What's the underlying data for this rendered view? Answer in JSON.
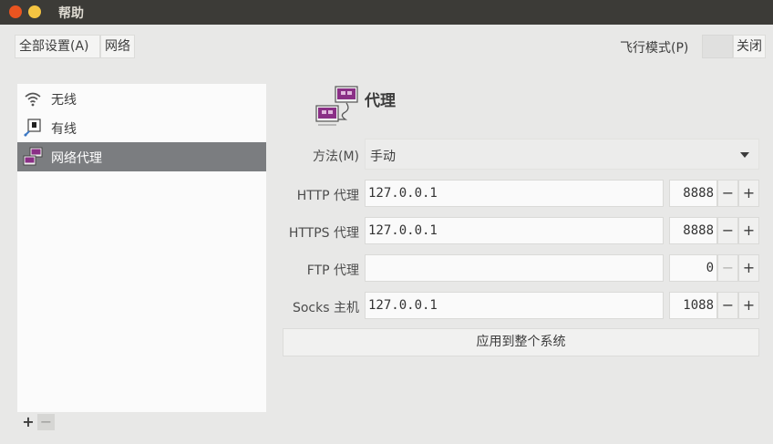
{
  "window": {
    "title": "帮助"
  },
  "header": {
    "breadcrumb_all": "全部设置(A)",
    "breadcrumb_network": "网络",
    "airplane_label": "飞行模式(P)",
    "airplane_state": "关闭"
  },
  "sidebar": {
    "items": [
      {
        "label": "无线",
        "icon": "wifi-icon"
      },
      {
        "label": "有线",
        "icon": "wired-icon"
      },
      {
        "label": "网络代理",
        "icon": "network-proxy-icon",
        "selected": true
      }
    ],
    "add_label": "+",
    "remove_label": "−"
  },
  "proxy": {
    "title": "代理",
    "method_label": "方法(M)",
    "method_value": "手动",
    "rows": [
      {
        "label": "HTTP 代理",
        "host": "127.0.0.1",
        "port": "8888"
      },
      {
        "label": "HTTPS 代理",
        "host": "127.0.0.1",
        "port": "8888"
      },
      {
        "label": "FTP 代理",
        "host": "",
        "port": "0"
      },
      {
        "label": "Socks 主机",
        "host": "127.0.0.1",
        "port": "1088"
      }
    ],
    "stepper_minus": "−",
    "stepper_plus": "+",
    "apply_label": "应用到整个系统"
  },
  "colors": {
    "titlebar": "#3c3b37",
    "close_button": "#e95420",
    "minimize_button": "#f5c542",
    "selection": "#7b7d80",
    "proxy_icon_accent": "#8a2f86"
  }
}
